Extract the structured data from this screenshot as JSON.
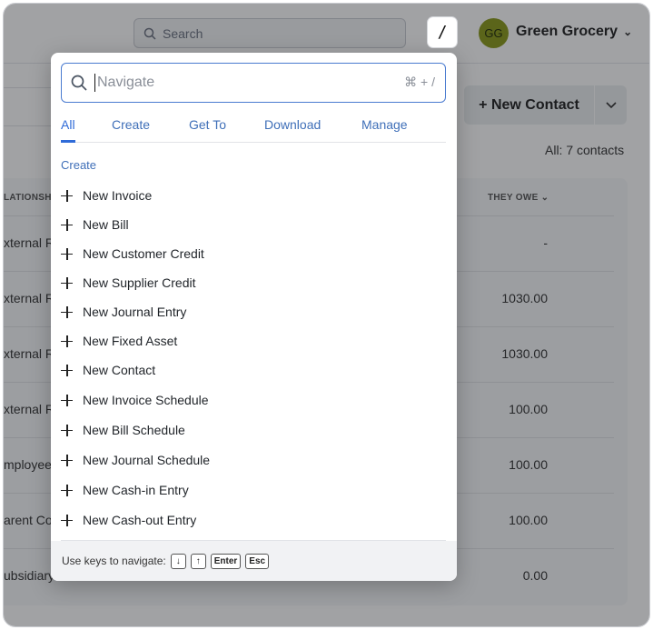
{
  "header": {
    "search_placeholder": "Search",
    "slash_key": "/",
    "avatar_initials": "GG",
    "company_name": "Green Grocery"
  },
  "background": {
    "new_contact_label": "+ New Contact",
    "contacts_count": "All: 7 contacts",
    "column_relationship": "LATIONSHIP",
    "column_they_owe": "THEY OWE",
    "rows": [
      {
        "relationship": "xternal R",
        "they_owe": "-"
      },
      {
        "relationship": "xternal R",
        "they_owe": "1030.00"
      },
      {
        "relationship": "xternal R",
        "they_owe": "1030.00"
      },
      {
        "relationship": "xternal R",
        "they_owe": "100.00"
      },
      {
        "relationship": "mployee",
        "they_owe": "100.00"
      },
      {
        "relationship": "arent Co",
        "they_owe": "100.00"
      },
      {
        "relationship": "ubsidiary",
        "they_owe": "0.00"
      }
    ]
  },
  "palette": {
    "input_placeholder": "Navigate",
    "shortcut_hint": "⌘ + /",
    "tabs": [
      {
        "label": "All",
        "active": true
      },
      {
        "label": "Create",
        "active": false
      },
      {
        "label": "Get To",
        "active": false
      },
      {
        "label": "Download",
        "active": false
      },
      {
        "label": "Manage",
        "active": false
      }
    ],
    "section_title": "Create",
    "items": [
      {
        "label": "New Invoice"
      },
      {
        "label": "New Bill"
      },
      {
        "label": "New Customer Credit"
      },
      {
        "label": "New Supplier Credit"
      },
      {
        "label": "New Journal Entry"
      },
      {
        "label": "New Fixed Asset"
      },
      {
        "label": "New Contact"
      },
      {
        "label": "New Invoice Schedule"
      },
      {
        "label": "New Bill Schedule"
      },
      {
        "label": "New Journal Schedule"
      },
      {
        "label": "New Cash-in Entry"
      },
      {
        "label": "New Cash-out Entry"
      }
    ],
    "footer": {
      "hint": "Use keys to navigate:",
      "keys": [
        "↓",
        "↑",
        "Enter",
        "Esc"
      ]
    }
  },
  "colors": {
    "accent": "#2f6bd8",
    "avatar_bg": "#8a9a1a"
  }
}
